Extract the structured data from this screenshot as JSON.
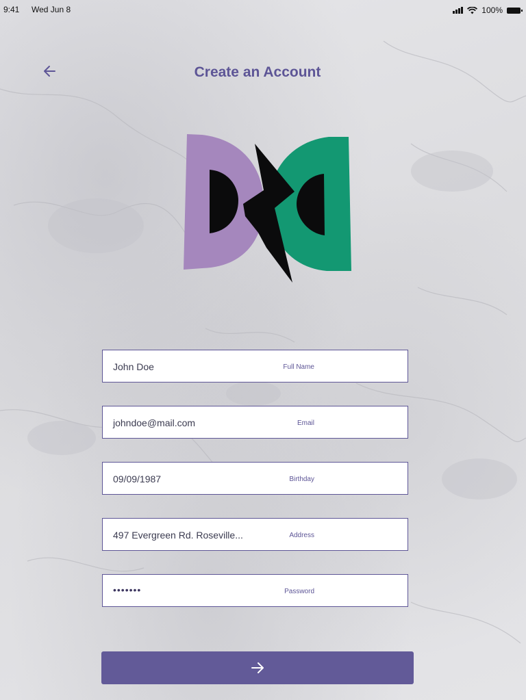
{
  "status_bar": {
    "time": "9:41",
    "date": "Wed Jun 8",
    "battery_percent": "100%"
  },
  "header": {
    "title": "Create an Account",
    "back_icon": "arrow-left-icon"
  },
  "logo": {
    "left_color": "#a587bd",
    "right_color": "#139872",
    "bolt_color": "#0c0c0c"
  },
  "form": {
    "fields": [
      {
        "label": "Full Name",
        "value": "John Doe"
      },
      {
        "label": "Email",
        "value": "johndoe@mail.com"
      },
      {
        "label": "Birthday",
        "value": "09/09/1987"
      },
      {
        "label": "Address",
        "value": "497 Evergreen Rd. Roseville..."
      },
      {
        "label": "Password",
        "value": "•••••••"
      }
    ],
    "submit_icon": "arrow-right-icon"
  },
  "colors": {
    "accent": "#5d5596",
    "button": "#625a98"
  }
}
